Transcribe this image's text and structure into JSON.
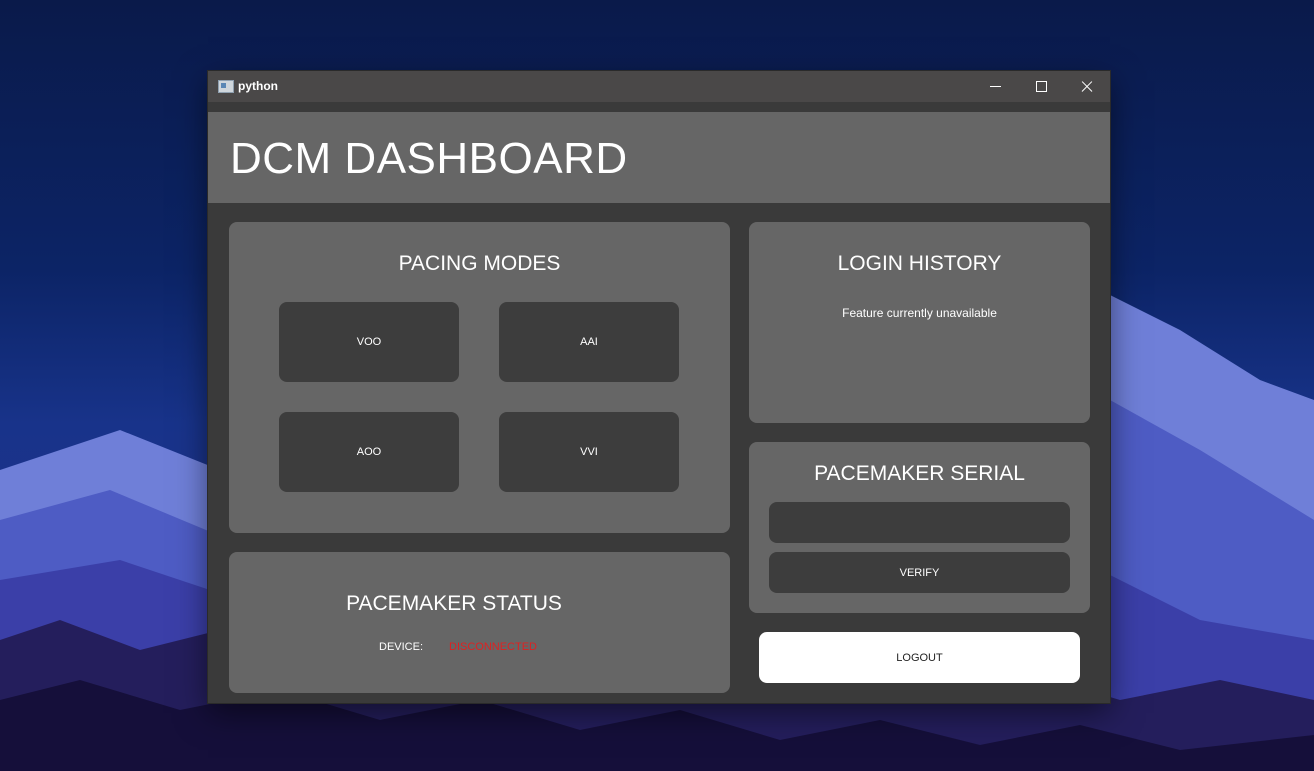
{
  "window": {
    "title": "python"
  },
  "header": {
    "title": "DCM DASHBOARD"
  },
  "pacing_modes": {
    "title": "PACING MODES",
    "buttons": [
      "VOO",
      "AAI",
      "AOO",
      "VVI"
    ]
  },
  "login_history": {
    "title": "LOGIN HISTORY",
    "note": "Feature currently unavailable"
  },
  "pacemaker_serial": {
    "title": "PACEMAKER SERIAL",
    "input_value": "",
    "verify_label": "VERIFY"
  },
  "pacemaker_status": {
    "title": "PACEMAKER STATUS",
    "device_label": "DEVICE:",
    "device_value": "DISCONNECTED",
    "device_value_color": "#dd2222"
  },
  "logout_label": "LOGOUT",
  "icons": {
    "app": "python-app-icon",
    "minimize": "minimize-icon",
    "maximize": "maximize-icon",
    "close": "close-icon"
  }
}
